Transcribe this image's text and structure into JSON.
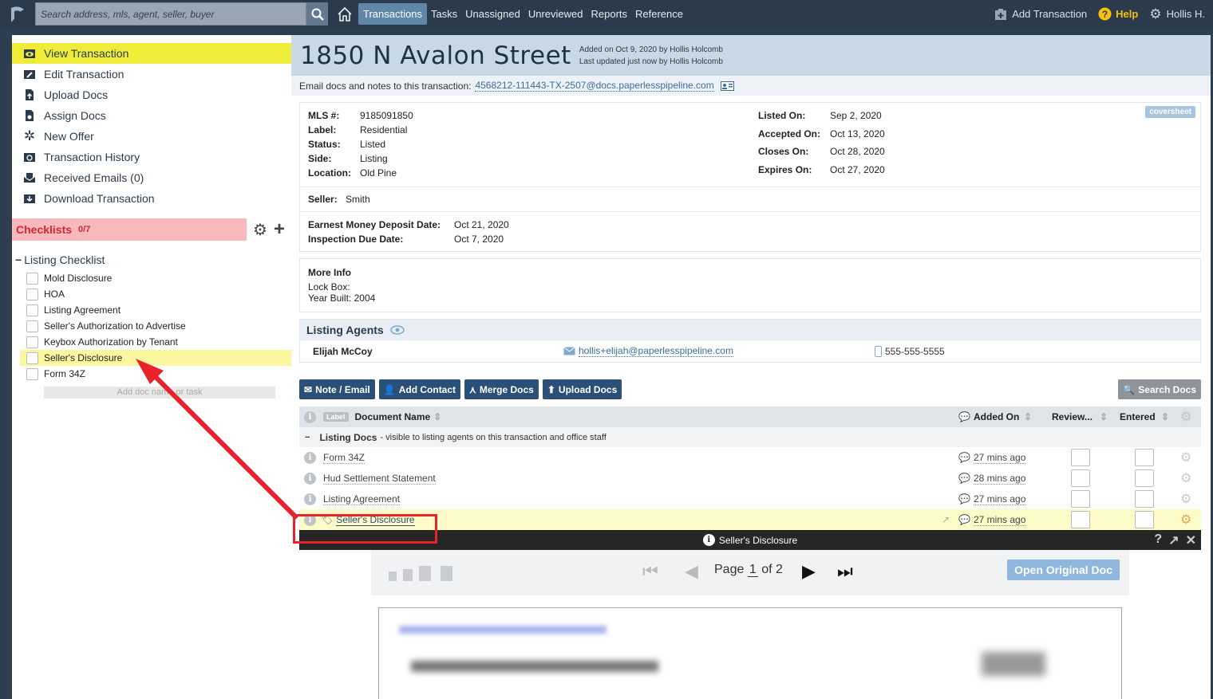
{
  "topbar": {
    "search_placeholder": "Search address, mls, agent, seller, buyer",
    "nav": [
      "Transactions",
      "Tasks",
      "Unassigned",
      "Unreviewed",
      "Reports",
      "Reference"
    ],
    "active_nav": "Transactions",
    "add_transaction": "Add Transaction",
    "help": "Help",
    "user": "Hollis H."
  },
  "sidebar": {
    "links": [
      "View Transaction",
      "Edit Transaction",
      "Upload Docs",
      "Assign Docs",
      "New Offer",
      "Transaction History",
      "Received Emails (0)",
      "Download Transaction"
    ],
    "active_link": "View Transaction",
    "checklists_title": "Checklists",
    "checklists_count": "0/7",
    "listing_checklist": "Listing Checklist",
    "items": [
      "Mold Disclosure",
      "HOA",
      "Listing Agreement",
      "Seller's Authorization to Advertise",
      "Keybox Authorization by Tenant",
      "Seller's Disclosure",
      "Form 34Z"
    ],
    "highlighted_item": "Seller's Disclosure",
    "add_doc": "Add doc name or task"
  },
  "transaction": {
    "address": "1850 N Avalon Street",
    "added_on": "Added on Oct 9, 2020 by Hollis Holcomb",
    "updated": "Last updated just now by Hollis Holcomb",
    "email_label": "Email docs and notes to this transaction:",
    "email": "4568212-111443-TX-2507@docs.paperlesspipeline.com",
    "coversheet": "coversheet",
    "mls_label": "MLS #:",
    "mls": "9185091850",
    "label_label": "Label:",
    "label": "Residential",
    "status_label": "Status:",
    "status": "Listed",
    "side_label": "Side:",
    "side": "Listing",
    "location_label": "Location:",
    "location": "Old Pine",
    "listed_label": "Listed On:",
    "listed": "Sep 2, 2020",
    "accepted_label": "Accepted On:",
    "accepted": "Oct 13, 2020",
    "closes_label": "Closes On:",
    "closes": "Oct 28, 2020",
    "expires_label": "Expires On:",
    "expires": "Oct 27, 2020",
    "seller_label": "Seller:",
    "seller": "Smith",
    "emd_label": "Earnest Money Deposit Date:",
    "emd": "Oct 21, 2020",
    "inspection_label": "Inspection Due Date:",
    "inspection": "Oct 7, 2020",
    "more_info": "More Info",
    "lock_box": "Lock Box:",
    "year_built": "Year Built: 2004"
  },
  "agents": {
    "title": "Listing Agents",
    "name": "Elijah McCoy",
    "email": "hollis+elijah@paperlesspipeline.com",
    "phone": "555-555-5555"
  },
  "buttons": {
    "note": "Note / Email",
    "contact": "Add Contact",
    "merge": "Merge Docs",
    "upload": "Upload Docs",
    "search": "Search Docs"
  },
  "docs": {
    "header": {
      "label_tag": "Label",
      "name": "Document Name",
      "added": "Added On",
      "review": "Review...",
      "entered": "Entered"
    },
    "section": "Listing Docs",
    "section_note": "- visible to listing agents on this transaction and office staff",
    "rows": [
      {
        "name": "Form 34Z",
        "added": "27 mins ago"
      },
      {
        "name": "Hud Settlement Statement",
        "added": "28 mins ago"
      },
      {
        "name": "Listing Agreement",
        "added": "27 mins ago"
      },
      {
        "name": "Seller's Disclosure",
        "added": "27 mins ago"
      }
    ]
  },
  "viewer": {
    "title": "Seller's Disclosure",
    "page_label": "Page",
    "page": "1",
    "of": "of 2",
    "open_btn": "Open Original Doc"
  }
}
